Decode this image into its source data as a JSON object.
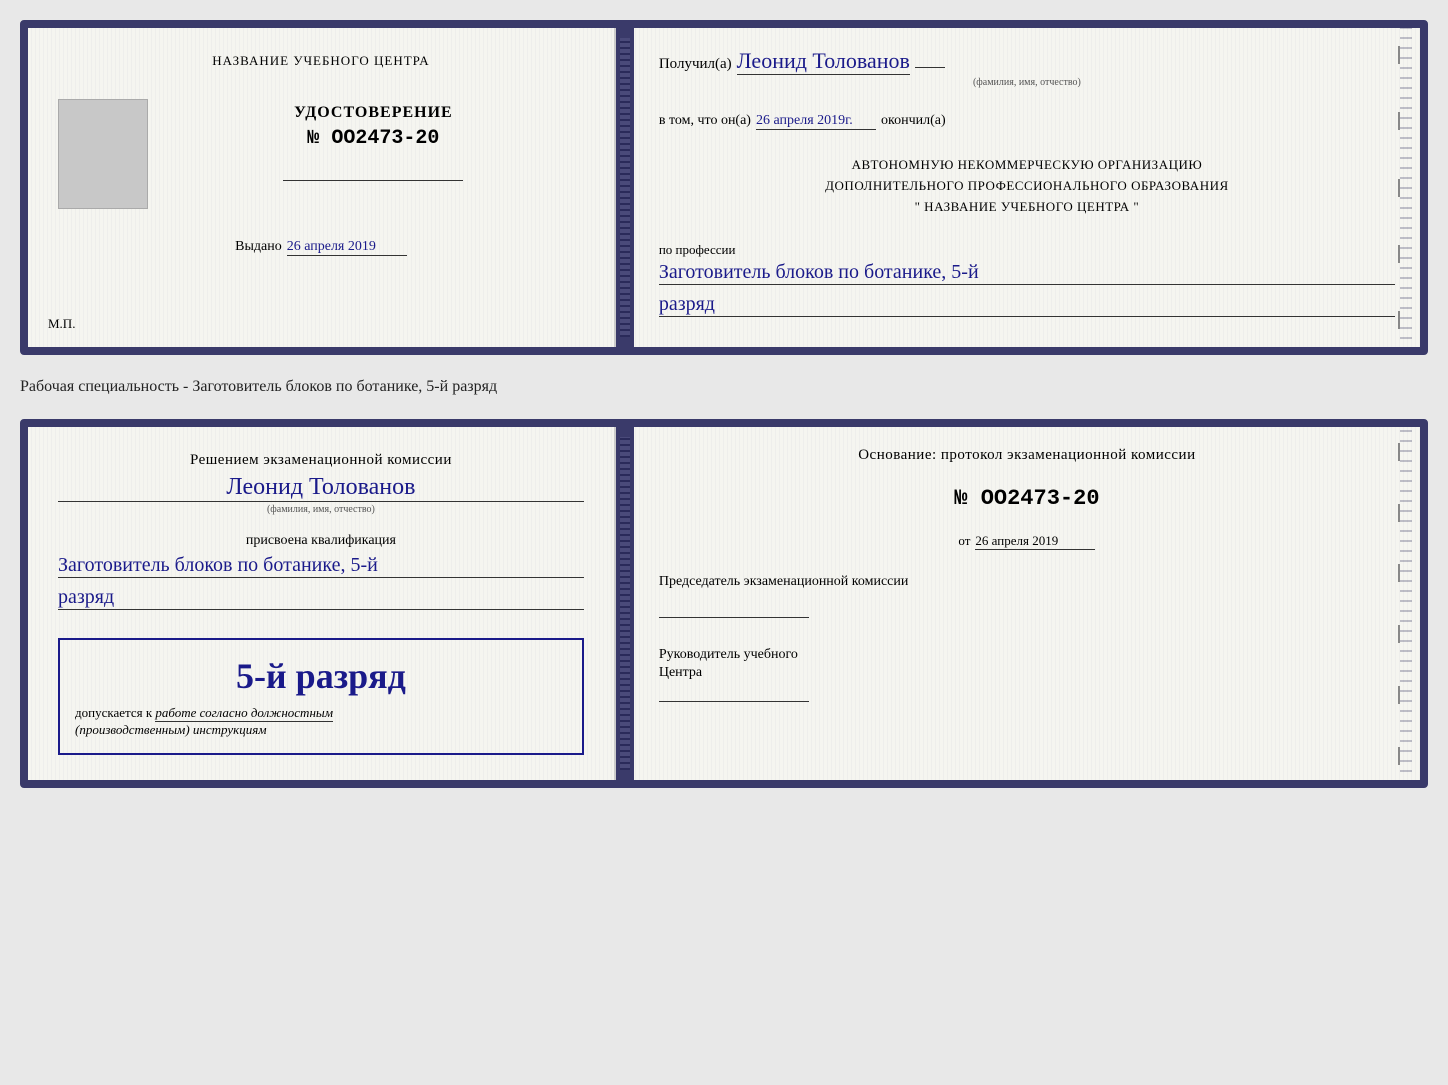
{
  "page": {
    "specialty_label": "Рабочая специальность - Заготовитель блоков по ботанике, 5-й разряд"
  },
  "top_document": {
    "left": {
      "center_title": "НАЗВАНИЕ УЧЕБНОГО ЦЕНТРА",
      "cert_label": "УДОСТОВЕРЕНИЕ",
      "cert_number": "№ OO2473-20",
      "issued_label": "Выдано",
      "issued_date": "26 апреля 2019",
      "mp_label": "М.П."
    },
    "right": {
      "received_prefix": "Получил(а)",
      "recipient_name": "Леонид Толованов",
      "recipient_hint": "(фамилия, имя, отчество)",
      "certify_prefix": "в том, что он(а)",
      "certify_date": "26 апреля 2019г.",
      "certify_suffix": "окончил(а)",
      "org_line1": "АВТОНОМНУЮ НЕКОММЕРЧЕСКУЮ ОРГАНИЗАЦИЮ",
      "org_line2": "ДОПОЛНИТЕЛЬНОГО ПРОФЕССИОНАЛЬНОГО ОБРАЗОВАНИЯ",
      "org_line3": "\"   НАЗВАНИЕ УЧЕБНОГО ЦЕНТРА   \"",
      "profession_label": "по профессии",
      "profession_name": "Заготовитель блоков по ботанике, 5-й",
      "rank_text": "разряд"
    }
  },
  "bottom_document": {
    "left": {
      "decision_prefix": "Решением экзаменационной комиссии",
      "person_name": "Леонид Толованов",
      "person_hint": "(фамилия, имя, отчество)",
      "assigned_label": "присвоена квалификация",
      "qualification": "Заготовитель блоков по ботанике, 5-й",
      "rank_text": "разряд",
      "rank_big": "5-й разряд",
      "допускается_prefix": "допускается к",
      "допускается_text": "работе согласно должностным",
      "instructions_text": "(производственным) инструкциям"
    },
    "right": {
      "basis_label": "Основание: протокол экзаменационной комиссии",
      "protocol_number": "№ OO2473-20",
      "from_prefix": "от",
      "from_date": "26 апреля 2019",
      "chairman_label": "Председатель экзаменационной комиссии",
      "head_label": "Руководитель учебного",
      "center_label": "Центра"
    }
  }
}
